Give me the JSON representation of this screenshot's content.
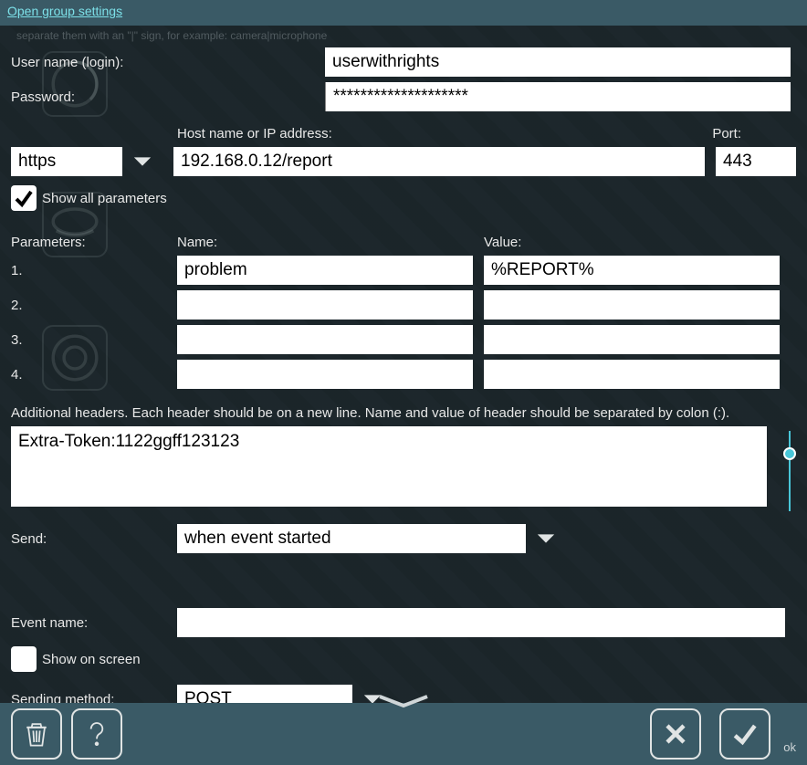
{
  "topbar": {
    "link": "Open group settings"
  },
  "hint": "separate them with an \"|\" sign, for example: camera|microphone",
  "labels": {
    "username": "User name (login):",
    "password": "Password:",
    "host": "Host name or IP address:",
    "port": "Port:",
    "show_all": "Show all parameters",
    "parameters": "Parameters:",
    "name": "Name:",
    "value": "Value:",
    "additional_headers": "Additional headers. Each header should be on a new line. Name and value of header should be separated by colon (:).",
    "send": "Send:",
    "event_name": "Event name:",
    "show_on_screen": "Show on screen",
    "sending_method": "Sending method:",
    "ok": "ok"
  },
  "form": {
    "username": "userwithrights",
    "password": "********************",
    "protocol": "https",
    "host": "192.168.0.12/report",
    "port": "443",
    "show_all_checked": true,
    "params": [
      {
        "num": "1.",
        "name": "problem",
        "value": "%REPORT%"
      },
      {
        "num": "2.",
        "name": "",
        "value": ""
      },
      {
        "num": "3.",
        "name": "",
        "value": ""
      },
      {
        "num": "4.",
        "name": "",
        "value": ""
      }
    ],
    "headers": "Extra-Token:1122ggff123123",
    "send_when": "when event started",
    "event_name": "",
    "show_on_screen_checked": false,
    "method": "POST"
  }
}
